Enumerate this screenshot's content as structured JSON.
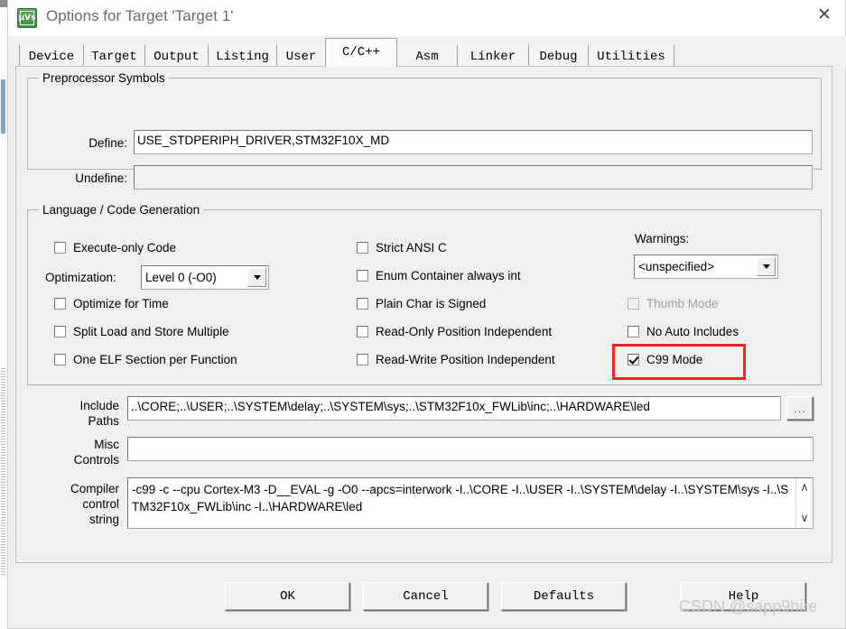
{
  "window": {
    "title": "Options for Target 'Target 1'",
    "app_icon": "keil-uvision-icon",
    "app_icon_glyph": "μVs",
    "close_glyph": "✕"
  },
  "tabs": [
    {
      "label": "Device",
      "active": false
    },
    {
      "label": "Target",
      "active": false
    },
    {
      "label": "Output",
      "active": false
    },
    {
      "label": "Listing",
      "active": false
    },
    {
      "label": "User",
      "active": false
    },
    {
      "label": "C/C++",
      "active": true
    },
    {
      "label": "Asm",
      "active": false
    },
    {
      "label": "Linker",
      "active": false
    },
    {
      "label": "Debug",
      "active": false
    },
    {
      "label": "Utilities",
      "active": false
    }
  ],
  "preprocessor": {
    "legend": "Preprocessor Symbols",
    "define_label": "Define:",
    "define_value": "USE_STDPERIPH_DRIVER,STM32F10X_MD",
    "undefine_label": "Undefine:",
    "undefine_value": ""
  },
  "language": {
    "legend": "Language / Code Generation",
    "left_column": [
      {
        "label": "Execute-only Code",
        "checked": false,
        "disabled": false
      },
      {
        "label": "Optimize for Time",
        "checked": false,
        "disabled": false
      },
      {
        "label": "Split Load and Store Multiple",
        "checked": false,
        "disabled": false
      },
      {
        "label": "One ELF Section per Function",
        "checked": false,
        "disabled": false
      }
    ],
    "optimization_label": "Optimization:",
    "optimization_value": "Level 0 (-O0)",
    "middle_column": [
      {
        "label": "Strict ANSI C",
        "checked": false,
        "disabled": false
      },
      {
        "label": "Enum Container always int",
        "checked": false,
        "disabled": false
      },
      {
        "label": "Plain Char is Signed",
        "checked": false,
        "disabled": false
      },
      {
        "label": "Read-Only Position Independent",
        "checked": false,
        "disabled": false
      },
      {
        "label": "Read-Write Position Independent",
        "checked": false,
        "disabled": false
      }
    ],
    "warnings_label": "Warnings:",
    "warnings_value": "<unspecified>",
    "right_column": [
      {
        "label": "Thumb Mode",
        "checked": false,
        "disabled": true
      },
      {
        "label": "No Auto Includes",
        "checked": false,
        "disabled": false
      },
      {
        "label": "C99 Mode",
        "checked": true,
        "disabled": false
      }
    ]
  },
  "paths": {
    "include_label_line1": "Include",
    "include_label_line2": "Paths",
    "include_value": "..\\CORE;..\\USER;..\\SYSTEM\\delay;..\\SYSTEM\\sys;..\\STM32F10x_FWLib\\inc;..\\HARDWARE\\led",
    "browse_label": "...",
    "misc_label_line1": "Misc",
    "misc_label_line2": "Controls",
    "misc_value": ""
  },
  "compiler": {
    "label_line1": "Compiler",
    "label_line2": "control",
    "label_line3": "string",
    "value": "-c99 -c --cpu Cortex-M3 -D__EVAL -g -O0 --apcs=interwork -I..\\CORE -I..\\USER -I..\\SYSTEM\\delay -I..\\SYSTEM\\sys -I..\\STM32F10x_FWLib\\inc -I..\\HARDWARE\\led",
    "scroll_up_glyph": "∧",
    "scroll_down_glyph": "∨"
  },
  "buttons": {
    "ok": "OK",
    "cancel": "Cancel",
    "defaults": "Defaults",
    "help": "Help"
  },
  "annotation": {
    "highlight_color": "#f4211e",
    "highlight_target": "C99 Mode"
  },
  "watermark": {
    "text": "CSDN @sapp9hire"
  }
}
